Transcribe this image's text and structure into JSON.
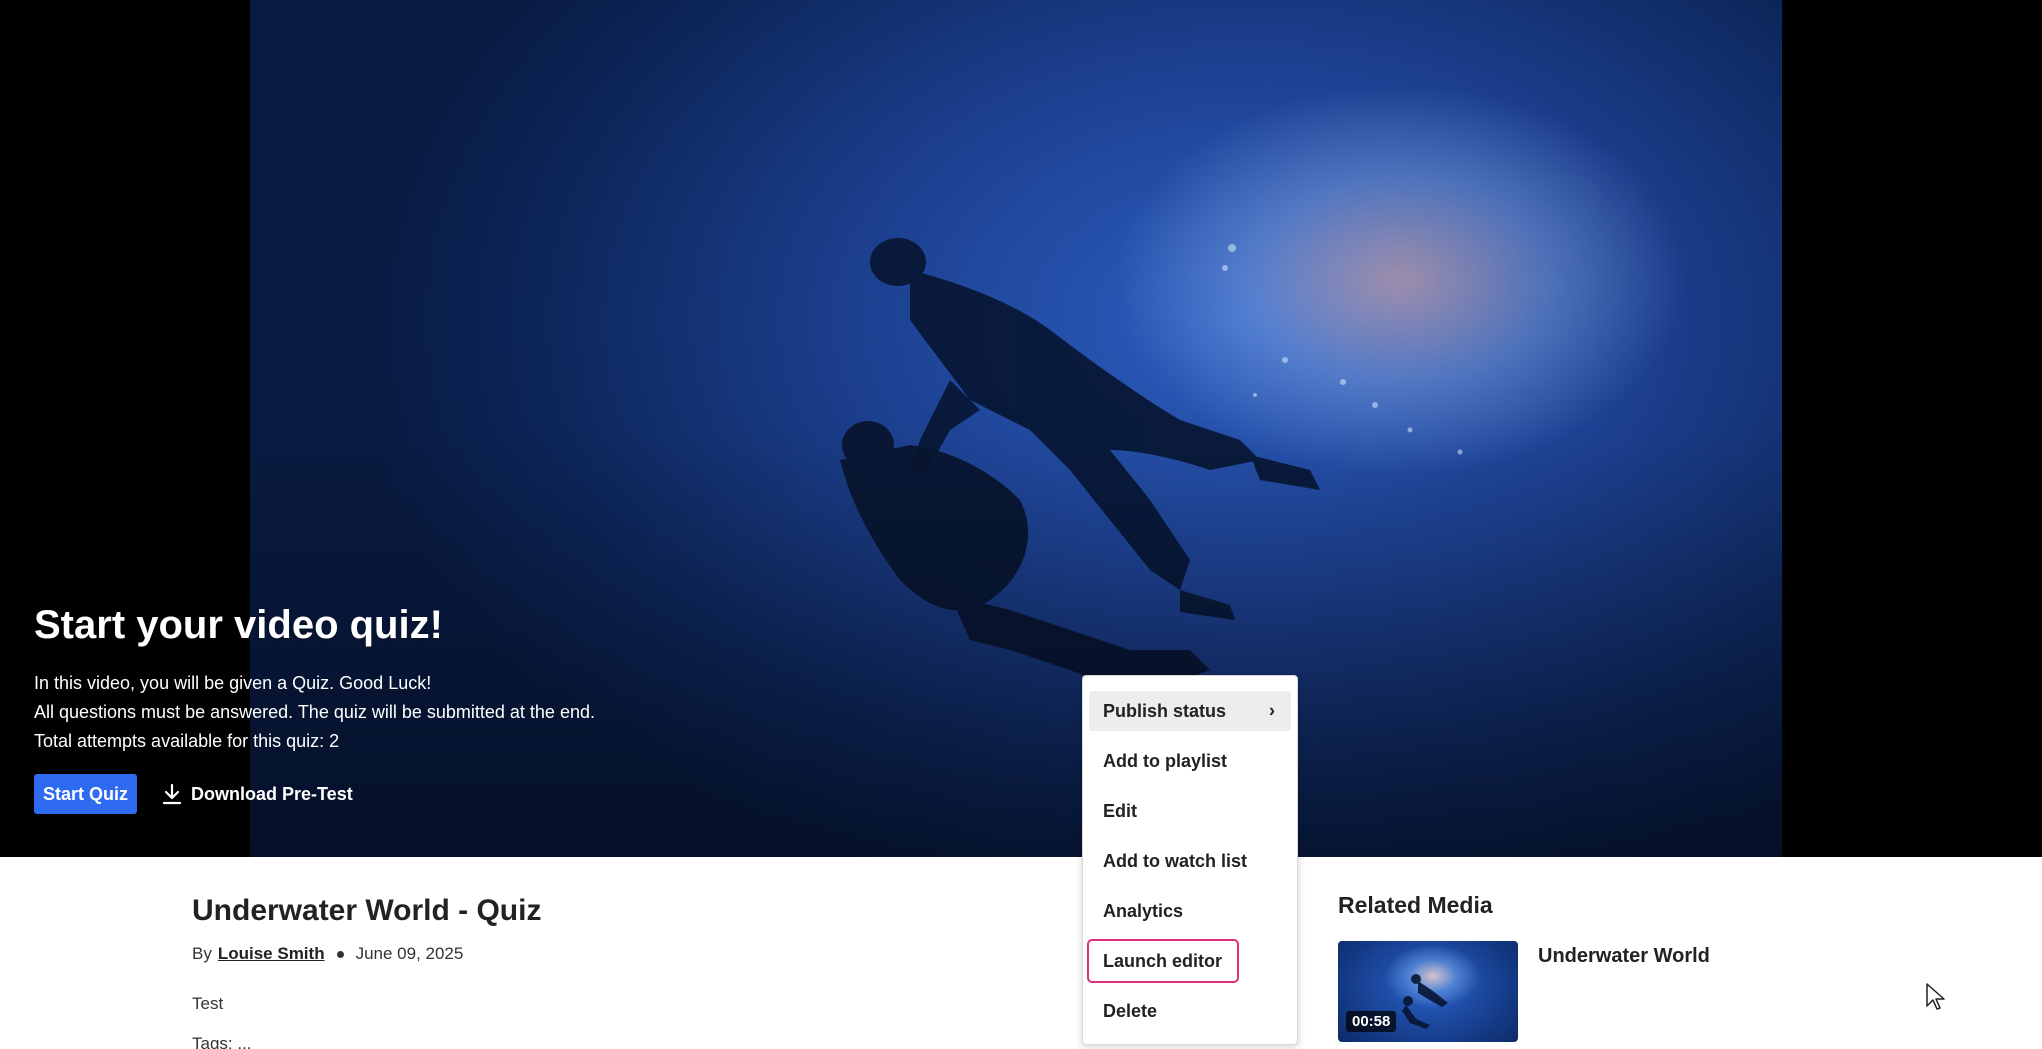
{
  "hero": {
    "title": "Start your video quiz!",
    "lines": [
      "In this video, you will be given a Quiz. Good Luck!",
      "All questions must be answered. The quiz will be submitted at the end.",
      "Total attempts available for this quiz: 2"
    ],
    "start_label": "Start Quiz",
    "download_label": "Download Pre-Test",
    "download_icon": "download-icon"
  },
  "media": {
    "title": "Underwater World - Quiz",
    "by_prefix": "By",
    "author": "Louise Smith",
    "date": "June 09, 2025",
    "description": "Test",
    "extra": "Tags: ..."
  },
  "related": {
    "heading": "Related Media",
    "items": [
      {
        "title": "Underwater World",
        "duration": "00:58"
      }
    ]
  },
  "menu": {
    "items": [
      {
        "label": "Publish status",
        "has_submenu": true,
        "state": "hover"
      },
      {
        "label": "Add to playlist"
      },
      {
        "label": "Edit"
      },
      {
        "label": "Add to watch list"
      },
      {
        "label": "Analytics"
      },
      {
        "label": "Launch editor",
        "state": "highlighted"
      },
      {
        "label": "Delete"
      }
    ],
    "submenu_icon": "chevron-right-icon"
  },
  "colors": {
    "primary_button": "#2f6bf0",
    "highlight_outline": "#e0307a",
    "hover_bg": "#ededed"
  }
}
